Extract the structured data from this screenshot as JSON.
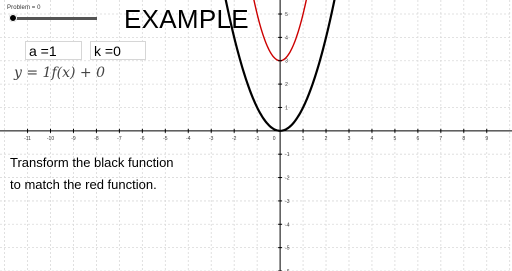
{
  "slider": {
    "label": "Problem = 0",
    "value": 0
  },
  "title": "EXAMPLE",
  "inputs": {
    "a_text": "a =1",
    "k_text": "k =0"
  },
  "formula": "y = 1f(x) + 0",
  "instruction": {
    "line1": "Transform the black function",
    "line2": "to match the red function."
  },
  "colors": {
    "grid": "#d9d9d9",
    "axis": "#000000",
    "black_curve": "#000000",
    "red_curve": "#cc0000"
  },
  "chart_data": {
    "type": "line",
    "x_ticks": [
      -11,
      -10,
      -9,
      -8,
      -7,
      -6,
      -5,
      -4,
      -3,
      -2,
      -1,
      1,
      2,
      3,
      4,
      5,
      6,
      7,
      8,
      9
    ],
    "y_ticks": [
      -6,
      -5,
      -4,
      -3,
      -2,
      -1,
      1,
      2,
      3,
      4,
      5
    ],
    "xlim": [
      -12.2,
      10.1
    ],
    "ylim": [
      -6.0,
      5.6
    ],
    "grid": true,
    "series": [
      {
        "color": "black",
        "function": "y = x^2",
        "a": 1,
        "k": 0
      },
      {
        "color": "red",
        "function": "y = 2x^2 + 3",
        "a": 2,
        "k": 3
      }
    ]
  }
}
